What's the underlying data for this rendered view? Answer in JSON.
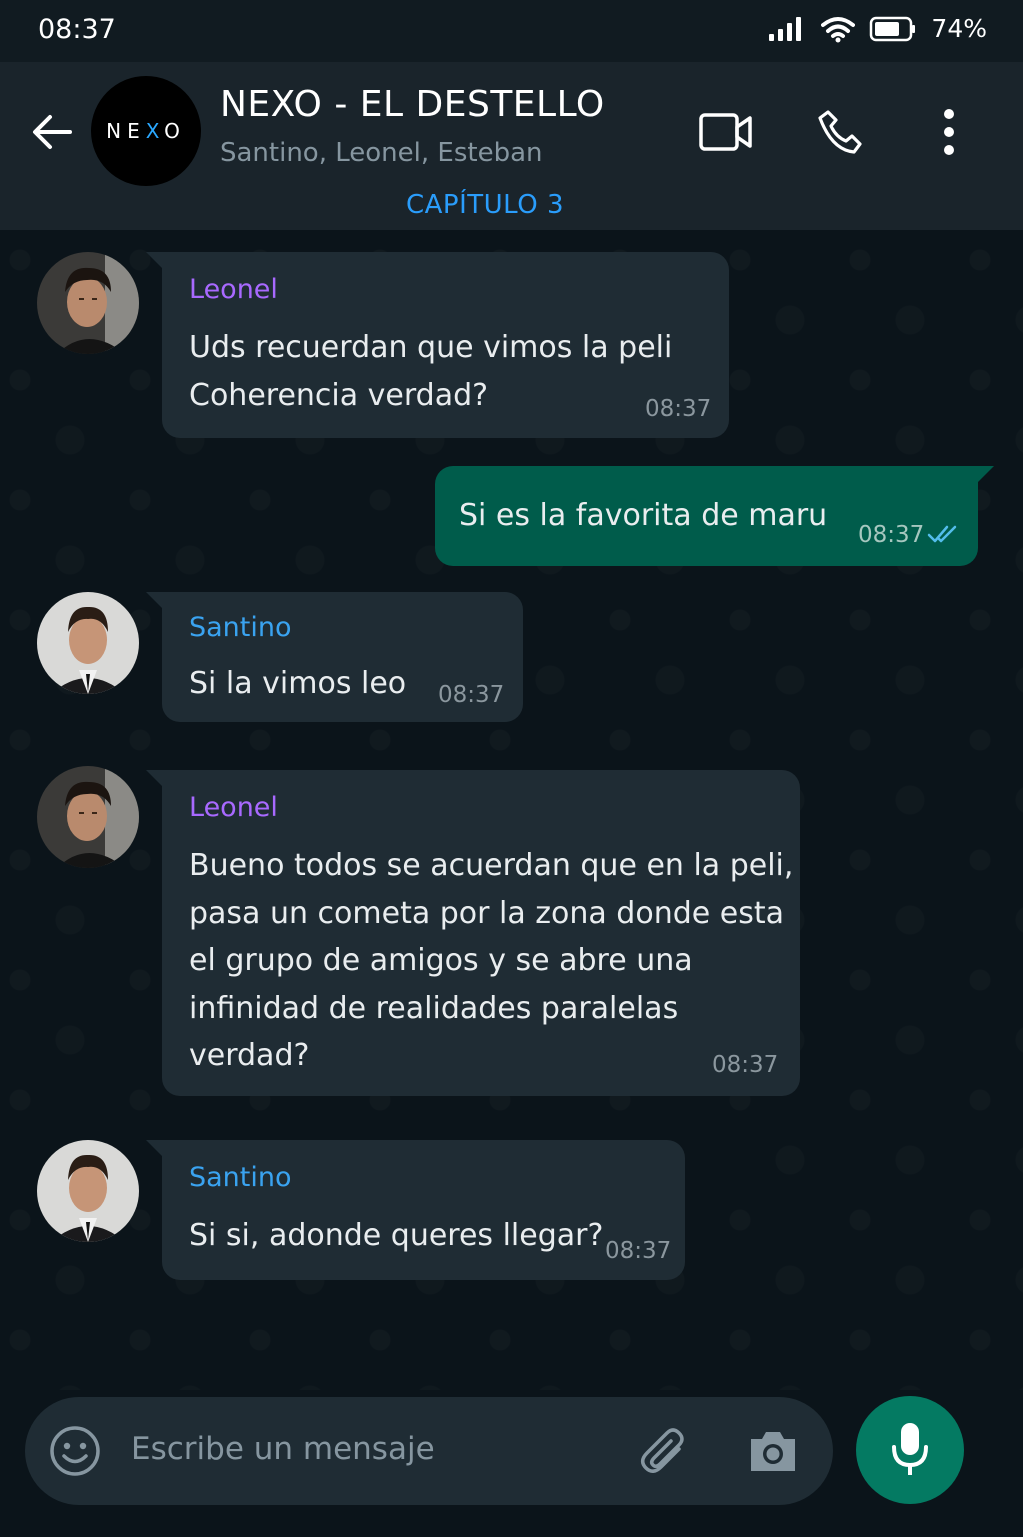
{
  "status_bar": {
    "time": "08:37",
    "battery": "74%"
  },
  "header": {
    "avatar_text_1": "NE",
    "avatar_text_x": "X",
    "avatar_text_2": "O",
    "title": "NEXO - EL DESTELLO",
    "subtitle": "Santino, Leonel, Esteban",
    "chapter": "CAPÍTULO 3"
  },
  "messages": [
    {
      "sender": "Leonel",
      "text": "Uds recuerdan que vimos la peli\nCoherencia verdad?",
      "time": "08:37"
    },
    {
      "sender": "",
      "text": "Si es la favorita de maru",
      "time": "08:37"
    },
    {
      "sender": "Santino",
      "text": "Si la vimos leo",
      "time": "08:37"
    },
    {
      "sender": "Leonel",
      "text": "Bueno todos se acuerdan que en la peli,\npasa un cometa por la zona donde esta\nel grupo de amigos y se abre una\ninfinidad de realidades paralelas verdad?",
      "time": "08:37"
    },
    {
      "sender": "Santino",
      "text": "Si si, adonde queres llegar?",
      "time": "08:37"
    }
  ],
  "input": {
    "placeholder": "Escribe un mensaje"
  },
  "colors": {
    "background": "#0b141a",
    "incoming_bubble": "#1f2c34",
    "outgoing_bubble": "#005c4b",
    "leonel": "#a869ff",
    "santino": "#3aa3f0",
    "accent": "#2a9dfb",
    "mic": "#047a62"
  },
  "icons": [
    "signal-icon",
    "wifi-icon",
    "battery-icon",
    "back-arrow-icon",
    "video-call-icon",
    "phone-icon",
    "more-options-icon",
    "read-receipt-icon",
    "emoji-icon",
    "attach-icon",
    "camera-icon",
    "mic-icon"
  ]
}
